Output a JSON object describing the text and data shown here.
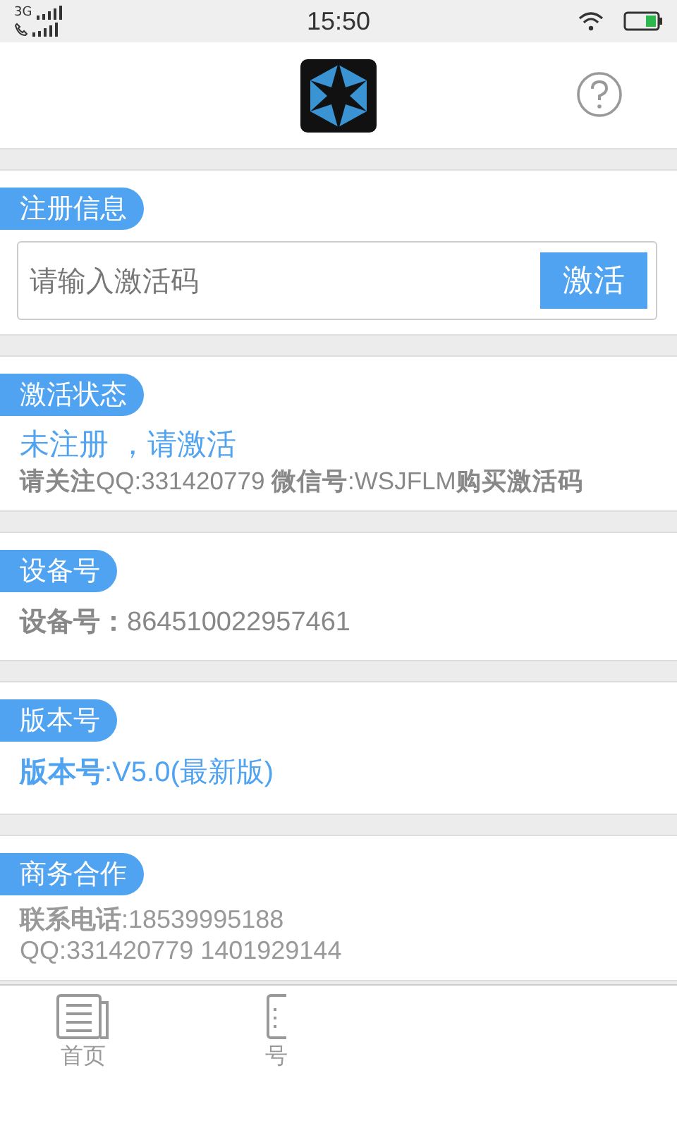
{
  "status_bar": {
    "network": "3G",
    "time": "15:50"
  },
  "sections": [
    {
      "kind": "input",
      "title": "注册信息",
      "placeholder": "请输入激活码",
      "button": "激活"
    },
    {
      "kind": "status",
      "title": "激活状态",
      "status": "未注册 ，请激活",
      "note": "**请关注**QQ:331420779 **微信号**:WSJFLM**购买激活码**"
    },
    {
      "kind": "value",
      "title": "设备号",
      "text": "**设备号：**864510022957461"
    },
    {
      "kind": "accent",
      "title": "版本号",
      "text": "**版本号**:V5.0(最新版)"
    },
    {
      "kind": "lines",
      "title": "商务合作",
      "lines": [
        "**联系电话**:18539995188",
        "QQ:331420779  1401929144"
      ]
    }
  ],
  "tab_bar": [
    {
      "label": "首页"
    },
    {
      "label": "号"
    }
  ]
}
